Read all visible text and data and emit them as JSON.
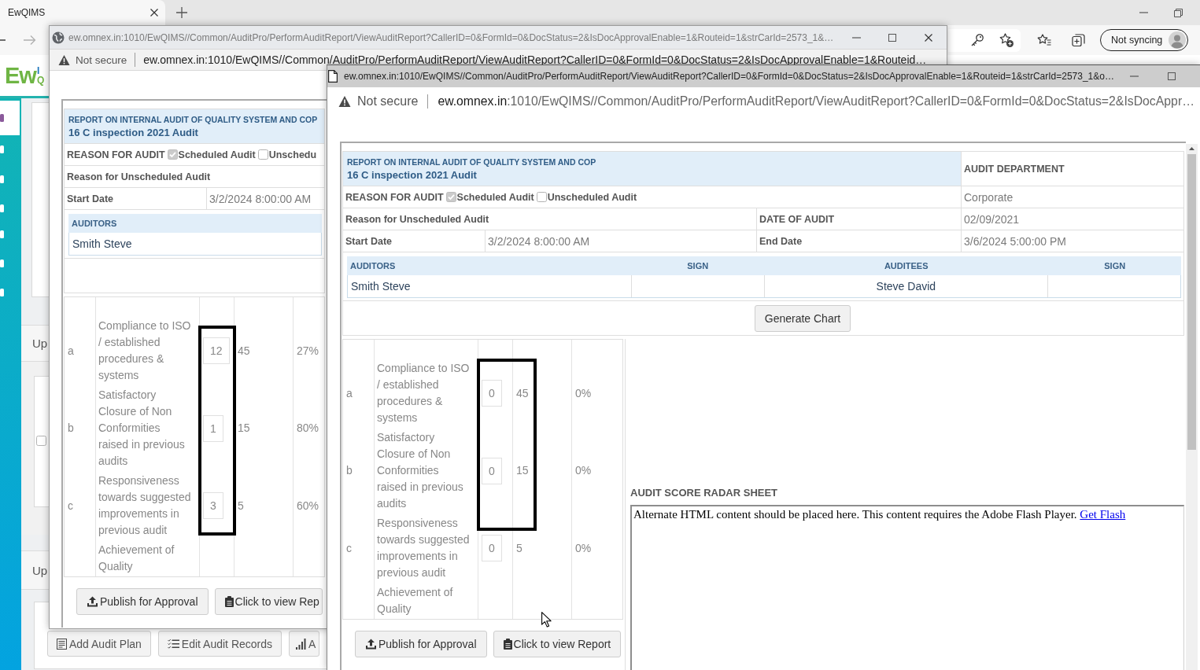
{
  "browser": {
    "tabs": [
      {
        "title": "EwQIMS",
        "selected": true
      }
    ],
    "profile": {
      "label": "Not syncing"
    }
  },
  "app": {
    "logo": {
      "main": "Ew",
      "upper": "I",
      "lower": "Q"
    },
    "sections": [
      {
        "heading": "Up",
        "checkbox": {
          "checked": false
        }
      },
      {
        "heading": "Up",
        "buttons": [
          "Add Audit Plan",
          "Edit Audit Records",
          "A"
        ]
      }
    ]
  },
  "windows": [
    {
      "kind": "back",
      "title": "ew.omnex.in:1010/EwQIMS//Common/AuditPro/PerformAuditReport/ViewAuditReport?CallerID=0&FormId=0&DocStatus=2&IsDocApprovalEnable=1&Routeid=1&strCarId=2573_1&…",
      "security": "Not secure",
      "address": {
        "host": "ew.omnex.in",
        "path": ":1010/EwQIMS//Common/AuditPro/PerformAuditReport/ViewAuditReport?CallerID=0&FormId=0&DocStatus=2&IsDocApprovalEnable=1&Routeid…"
      },
      "report": {
        "heading": "REPORT ON INTERNAL AUDIT OF QUALITY SYSTEM AND COP",
        "audit_name": "16 C inspection 2021 Audit",
        "reason_label": "REASON FOR AUDIT",
        "reasons": [
          {
            "label": "Scheduled Audit",
            "checked": true
          },
          {
            "label": "Unschedu",
            "checked": false
          }
        ],
        "unscheduled_reason_label": "Reason for Unscheduled Audit",
        "start_label": "Start Date",
        "start_date": "3/2/2024 8:00:00 AM",
        "people": [
          {
            "heading": "AUDITORS",
            "name": "Smith Steve"
          }
        ],
        "scores": [
          {
            "letter": "a",
            "criterion": "Compliance to ISO / established procedures & systems",
            "score": "12",
            "max": "45",
            "percent": "27%"
          },
          {
            "letter": "b",
            "criterion": "Satisfactory Closure of Non Conformities raised in previous audits",
            "score": "1",
            "max": "15",
            "percent": "80%"
          },
          {
            "letter": "c",
            "criterion": "Responsiveness towards suggested improvements in previous audit",
            "score": "3",
            "max": "5",
            "percent": "60%"
          },
          {
            "criterion": "Achievement of Quality"
          }
        ],
        "actions": [
          "Publish for Approval",
          "Click to view Rep"
        ]
      }
    },
    {
      "kind": "front",
      "title": "ew.omnex.in:1010/EwQIMS//Common/AuditPro/PerformAuditReport/ViewAuditReport?CallerID=0&FormId=0&DocStatus=2&IsDocApprovalEnable=1&Routeid=1&strCarId=2573_1&o…",
      "security": "Not secure",
      "address": {
        "host": "ew.omnex.in",
        "path": ":1010/EwQIMS//Common/AuditPro/PerformAuditReport/ViewAuditReport?CallerID=0&FormId=0&DocStatus=2&IsDocAppr…"
      },
      "report": {
        "heading": "REPORT ON INTERNAL AUDIT OF QUALITY SYSTEM AND COP",
        "audit_name": "16 C inspection 2021 Audit",
        "department_label": "AUDIT DEPARTMENT",
        "reason_label": "REASON FOR AUDIT",
        "reasons": [
          {
            "label": "Scheduled Audit",
            "checked": true
          },
          {
            "label": "Unscheduled Audit",
            "checked": false
          }
        ],
        "department": "Corporate",
        "unscheduled_reason_label": "Reason for Unscheduled Audit",
        "audit_date_label": "DATE OF AUDIT",
        "audit_date": "02/09/2021",
        "start_label": "Start Date",
        "start_date": "3/2/2024 8:00:00 AM",
        "end_label": "End Date",
        "end_date": "3/6/2024 5:00:00 PM",
        "people": [
          {
            "heading": "AUDITORS",
            "name": "Smith Steve"
          },
          {
            "heading": "SIGN"
          },
          {
            "heading": "AUDITEES",
            "name": "Steve David"
          },
          {
            "heading": "SIGN"
          }
        ],
        "chart_button": "Generate Chart",
        "scores": [
          {
            "letter": "a",
            "criterion": "Compliance to ISO / established procedures & systems",
            "score": "0",
            "max": "45",
            "percent": "0%"
          },
          {
            "letter": "b",
            "criterion": "Satisfactory Closure of Non Conformities raised in previous audits",
            "score": "0",
            "max": "15",
            "percent": "0%"
          },
          {
            "letter": "c",
            "criterion": "Responsiveness towards suggested improvements in previous audit",
            "score": "0",
            "max": "5",
            "percent": "0%"
          },
          {
            "criterion": "Achievement of Quality"
          }
        ],
        "radar": {
          "title": "AUDIT SCORE RADAR SHEET",
          "fallback_text": "Alternate HTML content should be placed here. This content requires the Adobe Flash Player.",
          "link": "Get Flash"
        },
        "actions": [
          "Publish for Approval",
          "Click to view Report"
        ]
      }
    }
  ]
}
